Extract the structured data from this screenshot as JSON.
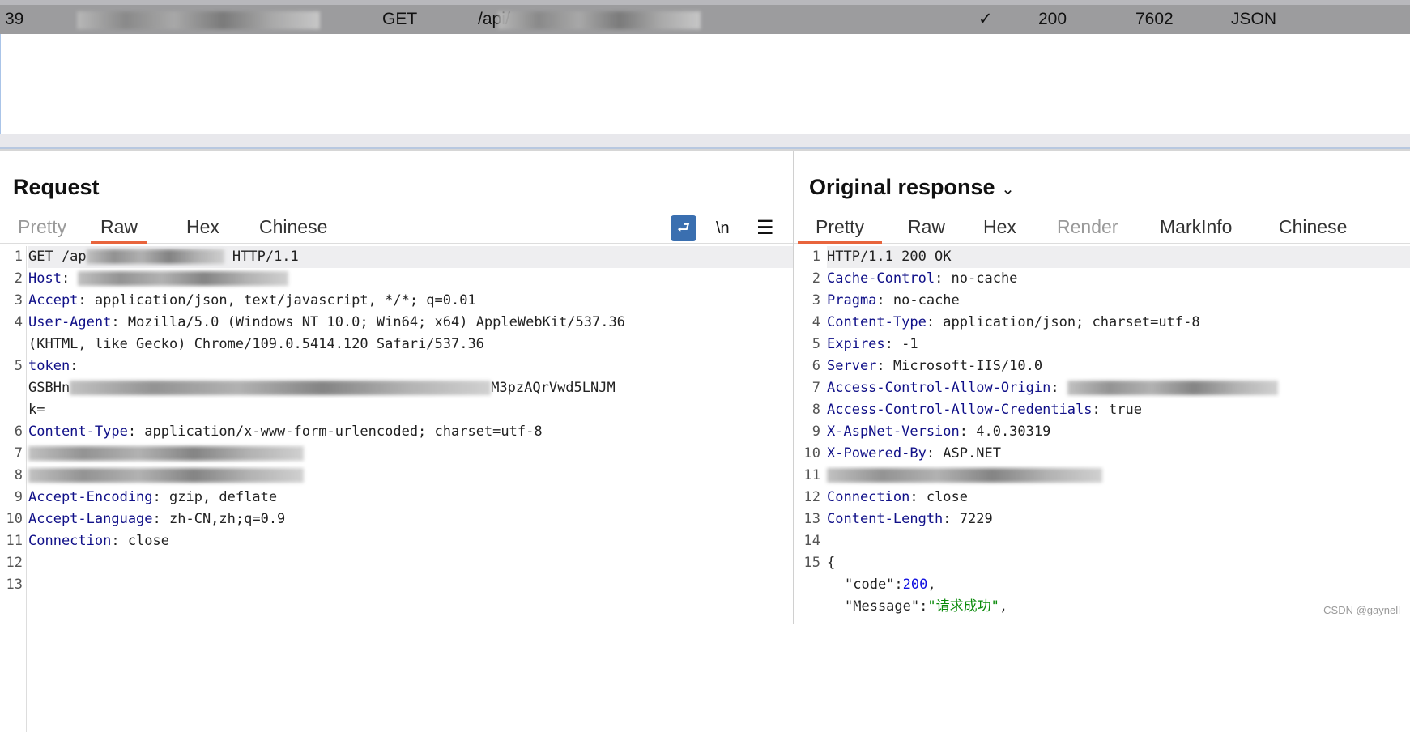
{
  "history_row": {
    "id": "39",
    "method": "GET",
    "path_prefix": "/api/",
    "edited": "✓",
    "status": "200",
    "length": "7602",
    "mime": "JSON"
  },
  "request": {
    "title": "Request",
    "tabs": [
      {
        "label": "Pretty"
      },
      {
        "label": "Raw"
      },
      {
        "label": "Hex"
      },
      {
        "label": "Chinese"
      }
    ],
    "selected_tab": "Raw",
    "icons": {
      "wrap": "word-wrap-icon",
      "newline": "\\n",
      "menu": "menu-icon"
    },
    "lines": [
      {
        "n": "1",
        "key": "",
        "text": "GET /ap",
        "tail": " HTTP/1.1",
        "blurred": true
      },
      {
        "n": "2",
        "key": "Host",
        "text": ": ",
        "blurred": true
      },
      {
        "n": "3",
        "key": "Accept",
        "text": ": application/json, text/javascript, */*; q=0.01"
      },
      {
        "n": "4",
        "key": "User-Agent",
        "text": ": Mozilla/5.0 (Windows NT 10.0; Win64; x64) AppleWebKit/537.36"
      },
      {
        "n": "",
        "key": "",
        "text": "(KHTML, like Gecko) Chrome/109.0.5414.120 Safari/537.36"
      },
      {
        "n": "5",
        "key": "token",
        "text": ":"
      },
      {
        "n": "",
        "key": "",
        "text": "GSBHn",
        "tail": "M3pzAQrVwd5LNJM",
        "blurred": true
      },
      {
        "n": "",
        "key": "",
        "text": "k="
      },
      {
        "n": "6",
        "key": "Content-Type",
        "text": ": application/x-www-form-urlencoded; charset=utf-8"
      },
      {
        "n": "7",
        "key": "",
        "text": "",
        "blurred": true
      },
      {
        "n": "8",
        "key": "",
        "text": "",
        "blurred": true
      },
      {
        "n": "9",
        "key": "Accept-Encoding",
        "text": ": gzip, deflate"
      },
      {
        "n": "10",
        "key": "Accept-Language",
        "text": ": zh-CN,zh;q=0.9"
      },
      {
        "n": "11",
        "key": "Connection",
        "text": ": close"
      },
      {
        "n": "12",
        "key": "",
        "text": ""
      },
      {
        "n": "13",
        "key": "",
        "text": ""
      }
    ]
  },
  "response": {
    "title": "Original response",
    "tabs": [
      {
        "label": "Pretty"
      },
      {
        "label": "Raw"
      },
      {
        "label": "Hex"
      },
      {
        "label": "Render"
      },
      {
        "label": "MarkInfo"
      },
      {
        "label": "Chinese"
      }
    ],
    "selected_tab": "Pretty",
    "lines": [
      {
        "n": "1",
        "key": "",
        "text": "HTTP/1.1 200 OK"
      },
      {
        "n": "2",
        "key": "Cache-Control",
        "text": ": no-cache"
      },
      {
        "n": "3",
        "key": "Pragma",
        "text": ": no-cache"
      },
      {
        "n": "4",
        "key": "Content-Type",
        "text": ": application/json; charset=utf-8"
      },
      {
        "n": "5",
        "key": "Expires",
        "text": ": -1"
      },
      {
        "n": "6",
        "key": "Server",
        "text": ": Microsoft-IIS/10.0"
      },
      {
        "n": "7",
        "key": "Access-Control-Allow-Origin",
        "text": ": ",
        "blurred": true
      },
      {
        "n": "8",
        "key": "Access-Control-Allow-Credentials",
        "text": ": true"
      },
      {
        "n": "9",
        "key": "X-AspNet-Version",
        "text": ": 4.0.30319"
      },
      {
        "n": "10",
        "key": "X-Powered-By",
        "text": ": ASP.NET"
      },
      {
        "n": "11",
        "key": "",
        "text": "",
        "blurred": true
      },
      {
        "n": "12",
        "key": "Connection",
        "text": ": close"
      },
      {
        "n": "13",
        "key": "Content-Length",
        "text": ": 7229"
      },
      {
        "n": "14",
        "key": "",
        "text": ""
      },
      {
        "n": "15",
        "key": "",
        "text": "{"
      }
    ],
    "json_lines": [
      {
        "key": "\"code\"",
        "sep": ":",
        "value": "200",
        "type": "number",
        "end": ","
      },
      {
        "key": "\"Message\"",
        "sep": ":",
        "value": "\"请求成功\"",
        "type": "string",
        "end": ","
      }
    ]
  },
  "watermark": "CSDN @gaynell",
  "colors": {
    "accent": "#e8643c",
    "header_key": "#101088",
    "json_number": "#1010e0",
    "json_string": "#0a8a0a",
    "selected_row": "#9c9c9e"
  }
}
